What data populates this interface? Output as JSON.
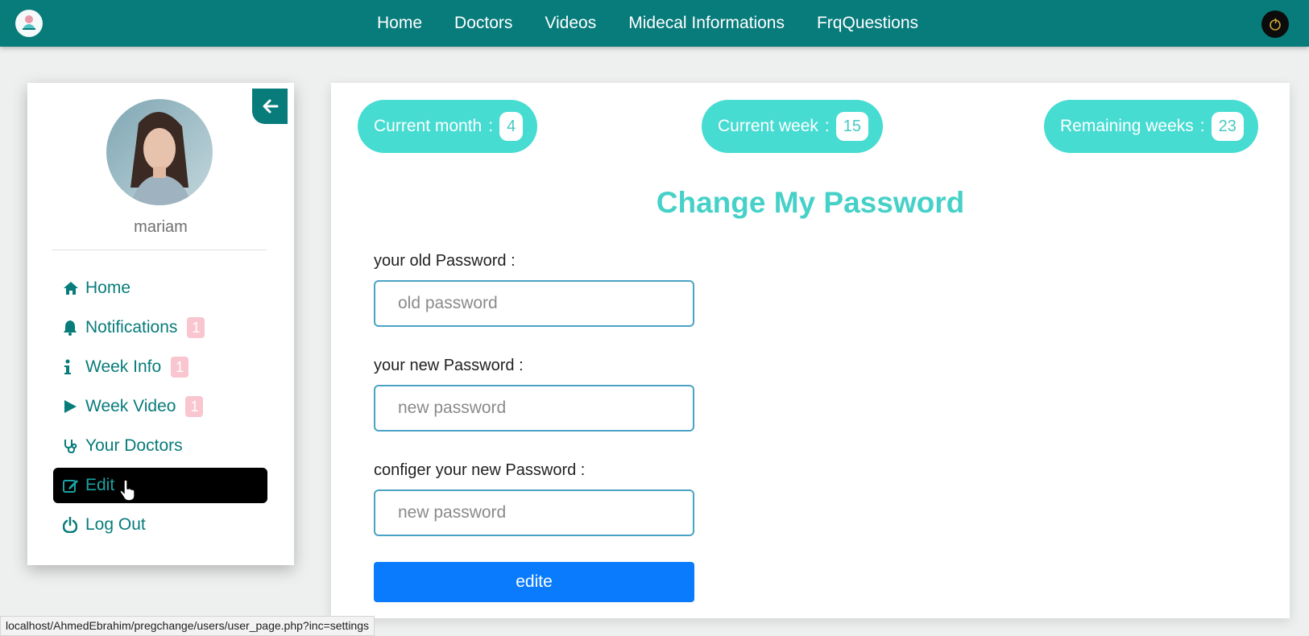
{
  "navbar": {
    "logo_icon": "app-logo-icon",
    "links": [
      "Home",
      "Doctors",
      "Videos",
      "Midecal Informations",
      "FrqQuestions"
    ],
    "avatar_icon": "user-avatar-icon",
    "color": "#087b7b"
  },
  "sidebar": {
    "back_icon": "arrow-left-icon",
    "username": "mariam",
    "items": [
      {
        "label": "Home",
        "icon": "home-icon",
        "badge": ""
      },
      {
        "label": "Notifications",
        "icon": "bell-icon",
        "badge": "1"
      },
      {
        "label": "Week Info",
        "icon": "info-icon",
        "badge": "1"
      },
      {
        "label": "Week Video",
        "icon": "play-icon",
        "badge": "1"
      },
      {
        "label": "Your Doctors",
        "icon": "stethoscope-icon",
        "badge": ""
      },
      {
        "label": "Edit",
        "icon": "edit-icon",
        "badge": "",
        "active": true
      },
      {
        "label": "Log Out",
        "icon": "power-icon",
        "badge": ""
      }
    ]
  },
  "stats": {
    "current_month_label": "Current month",
    "current_month_sep": ":",
    "current_month_value": "4",
    "current_week_label": "Current week",
    "current_week_sep": ":",
    "current_week_value": "15",
    "remaining_weeks_label": "Remaining weeks",
    "remaining_weeks_sep": ":",
    "remaining_weeks_value": "23",
    "color": "#46dcd2"
  },
  "form": {
    "title": "Change My Password",
    "old_label": "your old Password :",
    "old_placeholder": "old password",
    "new_label": "your new Password :",
    "new_placeholder": "new password",
    "confirm_label": "configer your new Password :",
    "confirm_placeholder": "new password",
    "submit_label": "edite",
    "submit_color": "#0a7bfd"
  },
  "status_bar": {
    "url": "localhost/AhmedEbrahim/pregchange/users/user_page.php?inc=settings"
  }
}
